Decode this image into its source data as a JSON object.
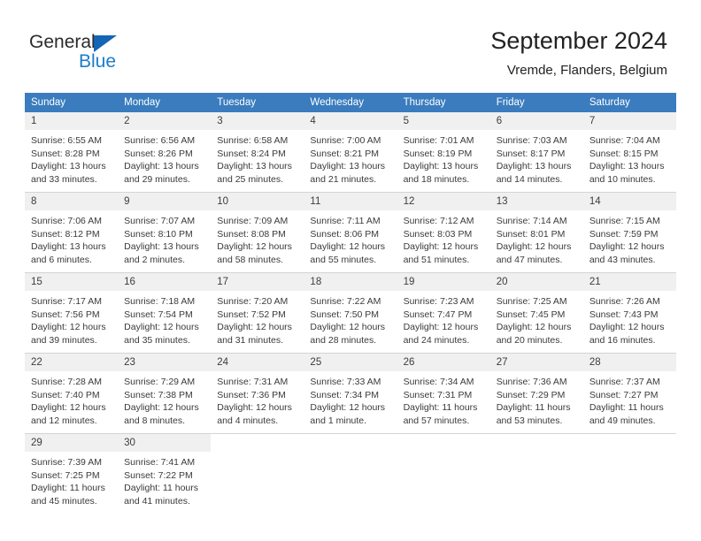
{
  "logo": {
    "word1": "General",
    "word2": "Blue",
    "triangle_color": "#1565b5",
    "word2_color": "#1a7ec8"
  },
  "header": {
    "title": "September 2024",
    "subtitle": "Vremde, Flanders, Belgium"
  },
  "theme": {
    "header_row_bg": "#3a7cbe",
    "daynum_bg": "#f0f0f0",
    "grid_line": "#d4d4d4"
  },
  "weekday_headers": [
    "Sunday",
    "Monday",
    "Tuesday",
    "Wednesday",
    "Thursday",
    "Friday",
    "Saturday"
  ],
  "weeks": [
    [
      {
        "day": "1",
        "sunrise": "Sunrise: 6:55 AM",
        "sunset": "Sunset: 8:28 PM",
        "daylight1": "Daylight: 13 hours",
        "daylight2": "and 33 minutes."
      },
      {
        "day": "2",
        "sunrise": "Sunrise: 6:56 AM",
        "sunset": "Sunset: 8:26 PM",
        "daylight1": "Daylight: 13 hours",
        "daylight2": "and 29 minutes."
      },
      {
        "day": "3",
        "sunrise": "Sunrise: 6:58 AM",
        "sunset": "Sunset: 8:24 PM",
        "daylight1": "Daylight: 13 hours",
        "daylight2": "and 25 minutes."
      },
      {
        "day": "4",
        "sunrise": "Sunrise: 7:00 AM",
        "sunset": "Sunset: 8:21 PM",
        "daylight1": "Daylight: 13 hours",
        "daylight2": "and 21 minutes."
      },
      {
        "day": "5",
        "sunrise": "Sunrise: 7:01 AM",
        "sunset": "Sunset: 8:19 PM",
        "daylight1": "Daylight: 13 hours",
        "daylight2": "and 18 minutes."
      },
      {
        "day": "6",
        "sunrise": "Sunrise: 7:03 AM",
        "sunset": "Sunset: 8:17 PM",
        "daylight1": "Daylight: 13 hours",
        "daylight2": "and 14 minutes."
      },
      {
        "day": "7",
        "sunrise": "Sunrise: 7:04 AM",
        "sunset": "Sunset: 8:15 PM",
        "daylight1": "Daylight: 13 hours",
        "daylight2": "and 10 minutes."
      }
    ],
    [
      {
        "day": "8",
        "sunrise": "Sunrise: 7:06 AM",
        "sunset": "Sunset: 8:12 PM",
        "daylight1": "Daylight: 13 hours",
        "daylight2": "and 6 minutes."
      },
      {
        "day": "9",
        "sunrise": "Sunrise: 7:07 AM",
        "sunset": "Sunset: 8:10 PM",
        "daylight1": "Daylight: 13 hours",
        "daylight2": "and 2 minutes."
      },
      {
        "day": "10",
        "sunrise": "Sunrise: 7:09 AM",
        "sunset": "Sunset: 8:08 PM",
        "daylight1": "Daylight: 12 hours",
        "daylight2": "and 58 minutes."
      },
      {
        "day": "11",
        "sunrise": "Sunrise: 7:11 AM",
        "sunset": "Sunset: 8:06 PM",
        "daylight1": "Daylight: 12 hours",
        "daylight2": "and 55 minutes."
      },
      {
        "day": "12",
        "sunrise": "Sunrise: 7:12 AM",
        "sunset": "Sunset: 8:03 PM",
        "daylight1": "Daylight: 12 hours",
        "daylight2": "and 51 minutes."
      },
      {
        "day": "13",
        "sunrise": "Sunrise: 7:14 AM",
        "sunset": "Sunset: 8:01 PM",
        "daylight1": "Daylight: 12 hours",
        "daylight2": "and 47 minutes."
      },
      {
        "day": "14",
        "sunrise": "Sunrise: 7:15 AM",
        "sunset": "Sunset: 7:59 PM",
        "daylight1": "Daylight: 12 hours",
        "daylight2": "and 43 minutes."
      }
    ],
    [
      {
        "day": "15",
        "sunrise": "Sunrise: 7:17 AM",
        "sunset": "Sunset: 7:56 PM",
        "daylight1": "Daylight: 12 hours",
        "daylight2": "and 39 minutes."
      },
      {
        "day": "16",
        "sunrise": "Sunrise: 7:18 AM",
        "sunset": "Sunset: 7:54 PM",
        "daylight1": "Daylight: 12 hours",
        "daylight2": "and 35 minutes."
      },
      {
        "day": "17",
        "sunrise": "Sunrise: 7:20 AM",
        "sunset": "Sunset: 7:52 PM",
        "daylight1": "Daylight: 12 hours",
        "daylight2": "and 31 minutes."
      },
      {
        "day": "18",
        "sunrise": "Sunrise: 7:22 AM",
        "sunset": "Sunset: 7:50 PM",
        "daylight1": "Daylight: 12 hours",
        "daylight2": "and 28 minutes."
      },
      {
        "day": "19",
        "sunrise": "Sunrise: 7:23 AM",
        "sunset": "Sunset: 7:47 PM",
        "daylight1": "Daylight: 12 hours",
        "daylight2": "and 24 minutes."
      },
      {
        "day": "20",
        "sunrise": "Sunrise: 7:25 AM",
        "sunset": "Sunset: 7:45 PM",
        "daylight1": "Daylight: 12 hours",
        "daylight2": "and 20 minutes."
      },
      {
        "day": "21",
        "sunrise": "Sunrise: 7:26 AM",
        "sunset": "Sunset: 7:43 PM",
        "daylight1": "Daylight: 12 hours",
        "daylight2": "and 16 minutes."
      }
    ],
    [
      {
        "day": "22",
        "sunrise": "Sunrise: 7:28 AM",
        "sunset": "Sunset: 7:40 PM",
        "daylight1": "Daylight: 12 hours",
        "daylight2": "and 12 minutes."
      },
      {
        "day": "23",
        "sunrise": "Sunrise: 7:29 AM",
        "sunset": "Sunset: 7:38 PM",
        "daylight1": "Daylight: 12 hours",
        "daylight2": "and 8 minutes."
      },
      {
        "day": "24",
        "sunrise": "Sunrise: 7:31 AM",
        "sunset": "Sunset: 7:36 PM",
        "daylight1": "Daylight: 12 hours",
        "daylight2": "and 4 minutes."
      },
      {
        "day": "25",
        "sunrise": "Sunrise: 7:33 AM",
        "sunset": "Sunset: 7:34 PM",
        "daylight1": "Daylight: 12 hours",
        "daylight2": "and 1 minute."
      },
      {
        "day": "26",
        "sunrise": "Sunrise: 7:34 AM",
        "sunset": "Sunset: 7:31 PM",
        "daylight1": "Daylight: 11 hours",
        "daylight2": "and 57 minutes."
      },
      {
        "day": "27",
        "sunrise": "Sunrise: 7:36 AM",
        "sunset": "Sunset: 7:29 PM",
        "daylight1": "Daylight: 11 hours",
        "daylight2": "and 53 minutes."
      },
      {
        "day": "28",
        "sunrise": "Sunrise: 7:37 AM",
        "sunset": "Sunset: 7:27 PM",
        "daylight1": "Daylight: 11 hours",
        "daylight2": "and 49 minutes."
      }
    ],
    [
      {
        "day": "29",
        "sunrise": "Sunrise: 7:39 AM",
        "sunset": "Sunset: 7:25 PM",
        "daylight1": "Daylight: 11 hours",
        "daylight2": "and 45 minutes."
      },
      {
        "day": "30",
        "sunrise": "Sunrise: 7:41 AM",
        "sunset": "Sunset: 7:22 PM",
        "daylight1": "Daylight: 11 hours",
        "daylight2": "and 41 minutes."
      },
      {
        "day": "",
        "sunrise": "",
        "sunset": "",
        "daylight1": "",
        "daylight2": ""
      },
      {
        "day": "",
        "sunrise": "",
        "sunset": "",
        "daylight1": "",
        "daylight2": ""
      },
      {
        "day": "",
        "sunrise": "",
        "sunset": "",
        "daylight1": "",
        "daylight2": ""
      },
      {
        "day": "",
        "sunrise": "",
        "sunset": "",
        "daylight1": "",
        "daylight2": ""
      },
      {
        "day": "",
        "sunrise": "",
        "sunset": "",
        "daylight1": "",
        "daylight2": ""
      }
    ]
  ]
}
